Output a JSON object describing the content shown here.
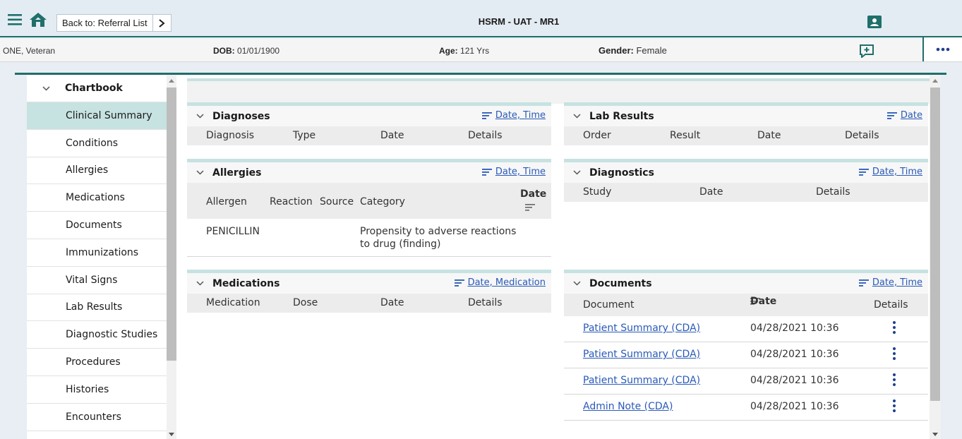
{
  "header": {
    "back_label": "Back to: Referral List",
    "app_title": "HSRM - UAT - MR1",
    "icons": [
      "hamburger-icon",
      "home-icon",
      "chevron-right-icon",
      "profile-card-icon"
    ]
  },
  "patient": {
    "name": "ONE, Veteran",
    "dob_label": "DOB:",
    "dob": "01/01/1900",
    "age_label": "Age:",
    "age": "121 Yrs",
    "gender_label": "Gender:",
    "gender": "Female"
  },
  "sidebar": {
    "section": "Chartbook",
    "items": [
      {
        "label": "Clinical Summary"
      },
      {
        "label": "Conditions"
      },
      {
        "label": "Allergies"
      },
      {
        "label": "Medications"
      },
      {
        "label": "Documents"
      },
      {
        "label": "Immunizations"
      },
      {
        "label": "Vital Signs"
      },
      {
        "label": "Lab Results"
      },
      {
        "label": "Diagnostic Studies"
      },
      {
        "label": "Procedures"
      },
      {
        "label": "Histories"
      },
      {
        "label": "Encounters"
      }
    ]
  },
  "panels": {
    "diagnoses": {
      "title": "Diagnoses",
      "sort": "Date, Time",
      "columns": [
        "Diagnosis",
        "Type",
        "Date",
        "Details"
      ]
    },
    "allergies": {
      "title": "Allergies",
      "sort": "Date, Time",
      "columns": [
        "Allergen",
        "Reaction",
        "Source",
        "Category",
        "Date"
      ],
      "rows": [
        {
          "allergen": "PENICILLIN",
          "category_line1": "Propensity to adverse reactions",
          "category_line2": "to drug (finding)"
        }
      ]
    },
    "medications": {
      "title": "Medications",
      "sort": "Date, Medication",
      "columns": [
        "Medication",
        "Dose",
        "Date",
        "Details"
      ]
    },
    "lab_results": {
      "title": "Lab Results",
      "sort": "Date",
      "columns": [
        "Order",
        "Result",
        "Date",
        "Details"
      ]
    },
    "diagnostics": {
      "title": "Diagnostics",
      "sort": "Date, Time",
      "columns": [
        "Study",
        "Date",
        "Details"
      ]
    },
    "documents": {
      "title": "Documents",
      "sort": "Date, Time",
      "columns": [
        "Document",
        "Date",
        "Details"
      ],
      "rows": [
        {
          "document": "Patient Summary (CDA)",
          "date": "04/28/2021 10:36"
        },
        {
          "document": "Patient Summary (CDA)",
          "date": "04/28/2021 10:36"
        },
        {
          "document": "Patient Summary (CDA)",
          "date": "04/28/2021 10:36"
        },
        {
          "document": "Admin Note (CDA)",
          "date": "04/28/2021 10:36"
        }
      ]
    }
  },
  "colors": {
    "teal": "#1f6f6a",
    "active_nav": "#c6e2e1",
    "link": "#2a5ab8"
  }
}
